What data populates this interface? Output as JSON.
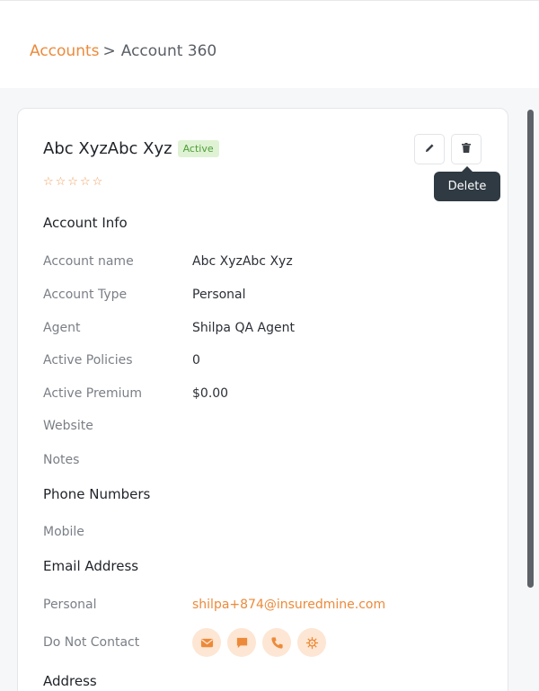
{
  "breadcrumb": {
    "parent": "Accounts",
    "separator": ">",
    "current": "Account 360"
  },
  "account": {
    "name": "Abc XyzAbc Xyz",
    "status": "Active",
    "rating_stars": "☆☆☆☆☆",
    "rating": 0
  },
  "actions": {
    "edit_icon": "pencil-icon",
    "delete_icon": "trash-icon",
    "tooltip": "Delete"
  },
  "sections": {
    "account_info": "Account Info",
    "phone_numbers": "Phone Numbers",
    "email_address": "Email Address",
    "address": "Address"
  },
  "fields": {
    "account_name": {
      "label": "Account name",
      "value": "Abc XyzAbc Xyz"
    },
    "account_type": {
      "label": "Account Type",
      "value": "Personal"
    },
    "agent": {
      "label": "Agent",
      "value": "Shilpa QA Agent"
    },
    "active_policies": {
      "label": "Active Policies",
      "value": "0"
    },
    "active_premium": {
      "label": "Active Premium",
      "value": "$0.00"
    },
    "website": {
      "label": "Website",
      "value": ""
    },
    "notes": {
      "label": "Notes",
      "value": ""
    },
    "mobile": {
      "label": "Mobile",
      "value": ""
    },
    "personal_email": {
      "label": "Personal",
      "value": "shilpa+874@insuredmine.com"
    },
    "do_not_contact": {
      "label": "Do Not Contact",
      "icons": [
        "mail-icon",
        "chat-icon",
        "phone-icon",
        "virus-icon"
      ]
    }
  },
  "colors": {
    "accent": "#ec8a3a",
    "badge_bg": "#dff3d4",
    "badge_text": "#4f9d3a",
    "tooltip_bg": "#2f3a42"
  }
}
